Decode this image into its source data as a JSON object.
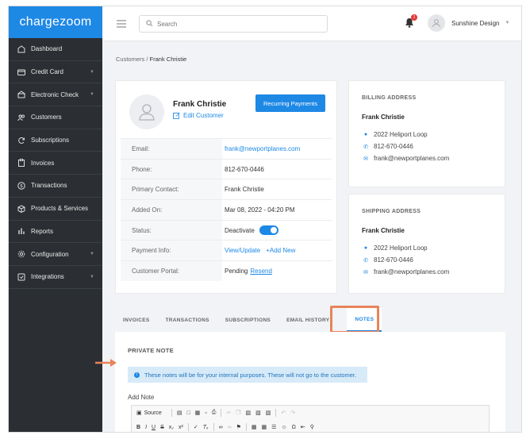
{
  "app": {
    "logo": "chargezoom"
  },
  "sidebar": {
    "items": [
      {
        "label": "Dashboard",
        "icon": "dashboard-icon",
        "has_caret": false
      },
      {
        "label": "Credit Card",
        "icon": "credit-card-icon",
        "has_caret": true
      },
      {
        "label": "Electronic Check",
        "icon": "bank-icon",
        "has_caret": true
      },
      {
        "label": "Customers",
        "icon": "users-icon",
        "has_caret": false
      },
      {
        "label": "Subscriptions",
        "icon": "refresh-icon",
        "has_caret": false
      },
      {
        "label": "Invoices",
        "icon": "clipboard-icon",
        "has_caret": false
      },
      {
        "label": "Transactions",
        "icon": "dollar-icon",
        "has_caret": false
      },
      {
        "label": "Products & Services",
        "icon": "box-icon",
        "has_caret": false
      },
      {
        "label": "Reports",
        "icon": "bar-chart-icon",
        "has_caret": false
      },
      {
        "label": "Configuration",
        "icon": "gear-icon",
        "has_caret": true
      },
      {
        "label": "Integrations",
        "icon": "plug-icon",
        "has_caret": true
      }
    ]
  },
  "topbar": {
    "search_placeholder": "Search",
    "notification_count": "1",
    "user_name": "Sunshine Design"
  },
  "breadcrumb": {
    "parent": "Customers",
    "separator": " / ",
    "current": "Frank Christie"
  },
  "customer": {
    "name": "Frank Christie",
    "edit_label": "Edit Customer",
    "action_button": "Recurring Payments",
    "fields": {
      "email": {
        "label": "Email:",
        "value": "frank@newportplanes.com"
      },
      "phone": {
        "label": "Phone:",
        "value": "812-670-0446"
      },
      "primary_contact": {
        "label": "Primary Contact:",
        "value": "Frank Christie"
      },
      "added_on": {
        "label": "Added On:",
        "value": "Mar 08, 2022 - 04:20 PM"
      },
      "status": {
        "label": "Status:",
        "value": "Deactivate",
        "toggle_on": true
      },
      "payment_info": {
        "label": "Payment Info:",
        "view_update": "View/Update",
        "add_new": "+Add New"
      },
      "customer_portal": {
        "label": "Customer Portal:",
        "value": "Pending",
        "resend": "Resend"
      }
    }
  },
  "billing": {
    "heading": "BILLING ADDRESS",
    "name": "Frank Christie",
    "address": "2022 Heliport Loop",
    "phone": "812-670-0446",
    "email": "frank@newportplanes.com"
  },
  "shipping": {
    "heading": "SHIPPING ADDRESS",
    "name": "Frank Christie",
    "address": "2022 Heliport Loop",
    "phone": "812-670-0446",
    "email": "frank@newportplanes.com"
  },
  "tabs": [
    {
      "label": "INVOICES",
      "active": false
    },
    {
      "label": "TRANSACTIONS",
      "active": false
    },
    {
      "label": "SUBSCRIPTIONS",
      "active": false
    },
    {
      "label": "EMAIL HISTORY",
      "active": false
    },
    {
      "label": "NOTES",
      "active": true
    }
  ],
  "notes": {
    "heading": "PRIVATE NOTE",
    "notice": "These notes will be for your internal purposes. These will not go to the customer.",
    "add_note_label": "Add Note",
    "source_label": "Source"
  },
  "colors": {
    "accent": "#1e88e5",
    "sidebar_bg": "#2b2f33",
    "highlight": "#e8835a",
    "notice_bg": "#d7eaf8"
  }
}
